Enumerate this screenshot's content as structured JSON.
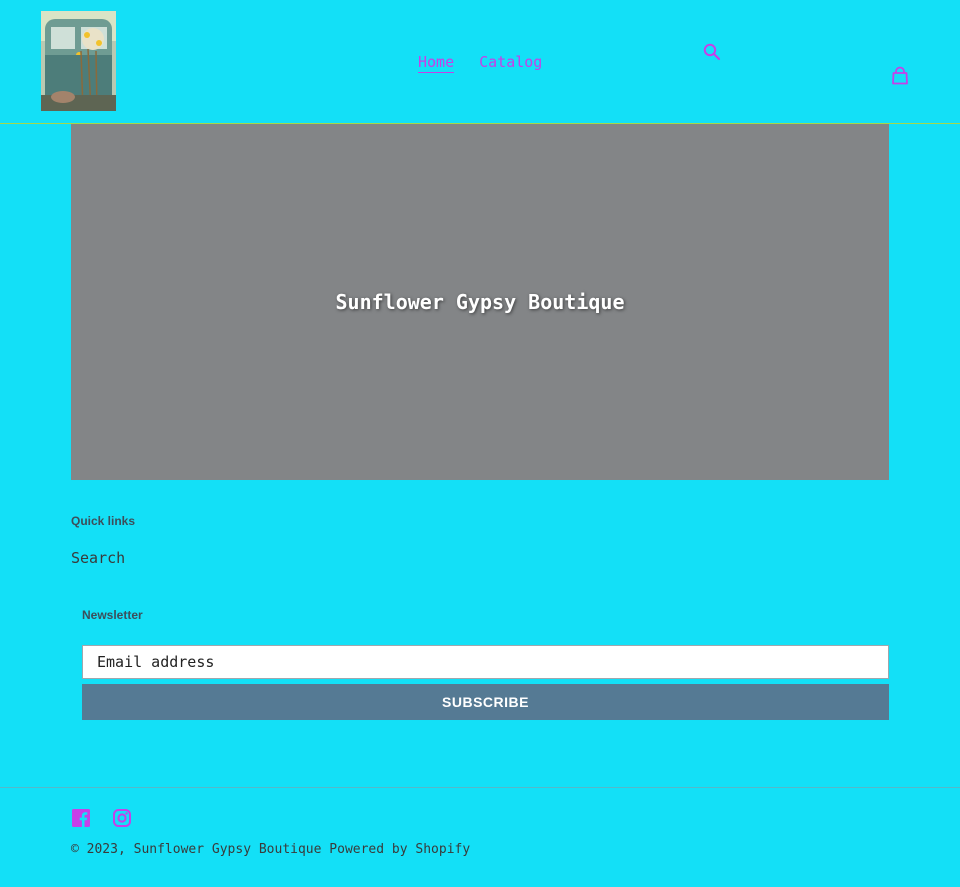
{
  "header": {
    "nav": [
      {
        "label": "Home"
      },
      {
        "label": "Catalog"
      }
    ]
  },
  "hero": {
    "title": "Sunflower Gypsy Boutique"
  },
  "footer": {
    "quick_links_title": "Quick links",
    "quick_links": [
      {
        "label": "Search"
      }
    ],
    "newsletter_title": "Newsletter",
    "email_placeholder": "Email address",
    "subscribe_label": "SUBSCRIBE",
    "social": [
      "facebook-icon",
      "instagram-icon"
    ],
    "copyright_prefix": "© 2023,",
    "store_name": "Sunflower Gypsy Boutique",
    "powered_by": "Powered by Shopify"
  },
  "colors": {
    "background": "#13e0f7",
    "accent": "#c640e8",
    "hero_overlay": "#838587",
    "button": "#557a94"
  }
}
